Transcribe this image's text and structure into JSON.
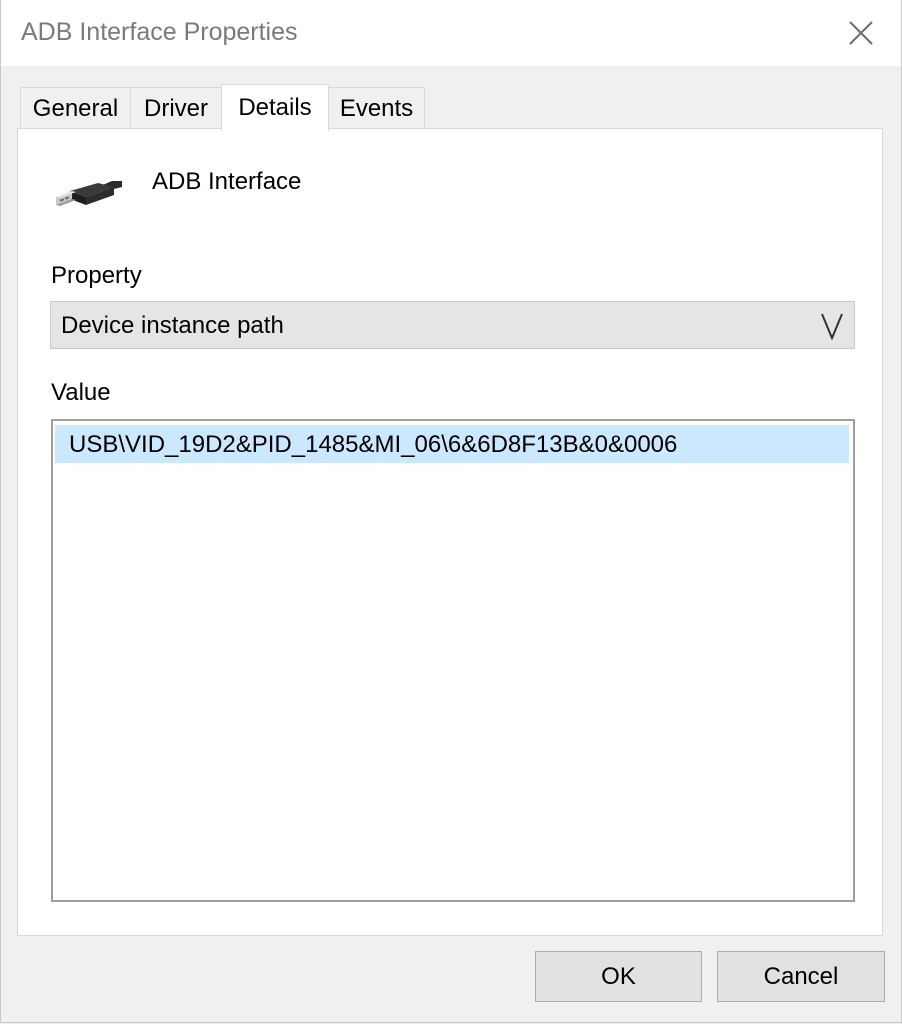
{
  "window": {
    "title": "ADB Interface Properties"
  },
  "tabs": [
    {
      "label": "General",
      "active": false
    },
    {
      "label": "Driver",
      "active": false
    },
    {
      "label": "Details",
      "active": true
    },
    {
      "label": "Events",
      "active": false
    }
  ],
  "details": {
    "device_name": "ADB Interface",
    "device_icon": "usb-plug-icon",
    "property_label": "Property",
    "property_selected": "Device instance path",
    "value_label": "Value",
    "values": [
      "USB\\VID_19D2&PID_1485&MI_06\\6&6D8F13B&0&0006"
    ]
  },
  "buttons": {
    "ok": "OK",
    "cancel": "Cancel"
  },
  "colors": {
    "selection": "#cce8ff",
    "button_bg": "#e1e1e1",
    "combo_bg": "#e5e5e5"
  }
}
